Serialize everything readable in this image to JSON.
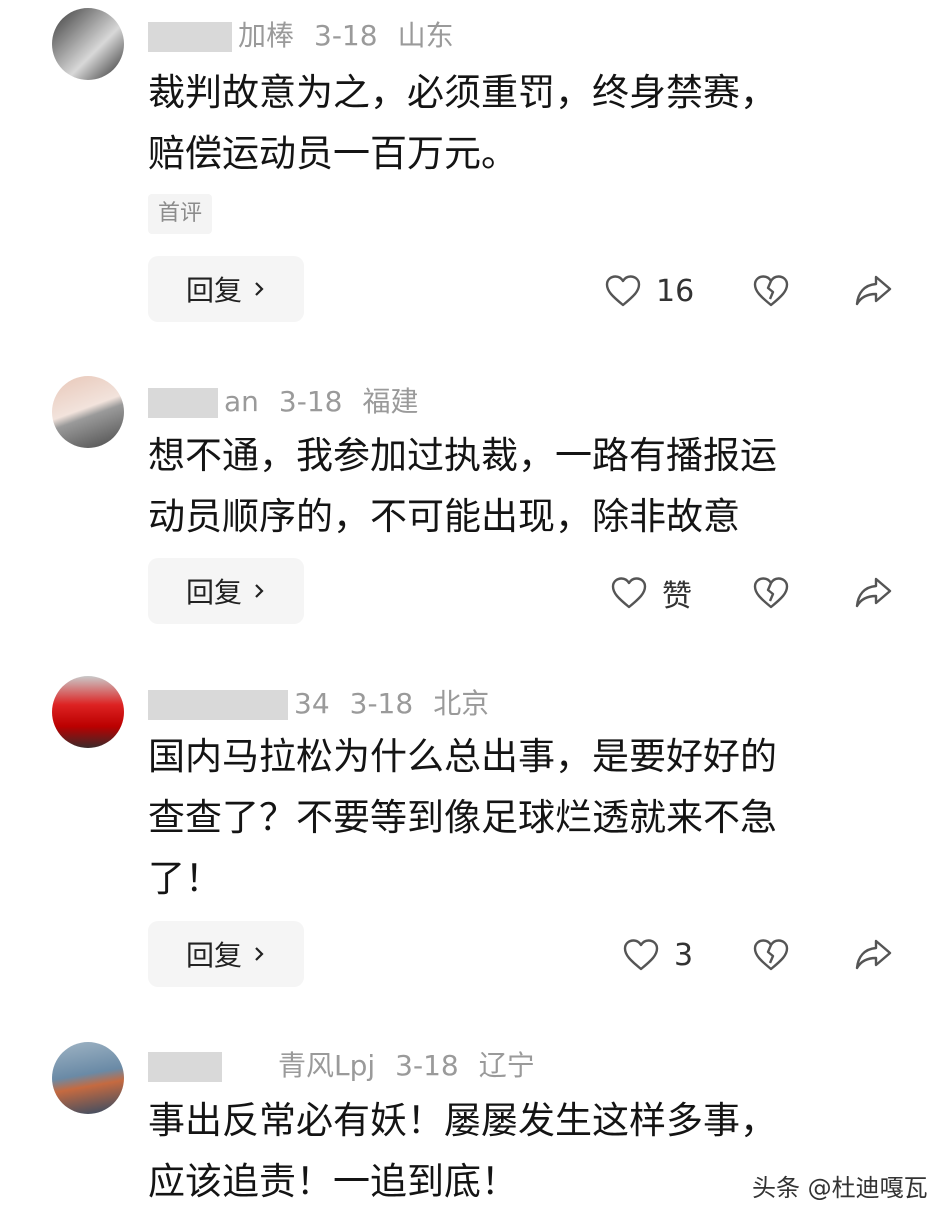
{
  "comments": [
    {
      "name_tail": "加棒",
      "date": "3-18",
      "location": "山东",
      "text_lines": [
        "裁判故意为之，必须重罚，终身禁赛，",
        "赔偿运动员一百万元。"
      ],
      "tag": "首评",
      "reply_label": "回复",
      "likes": "16"
    },
    {
      "name_tail": "an",
      "date": "3-18",
      "location": "福建",
      "text_lines": [
        "想不通，我参加过执裁，一路有播报运",
        "动员顺序的，不可能出现，除非故意"
      ],
      "reply_label": "回复",
      "likes": "赞"
    },
    {
      "name_tail": "34",
      "date": "3-18",
      "location": "北京",
      "text_lines": [
        "国内马拉松为什么总出事，是要好好的",
        "查查了？不要等到像足球烂透就来不急",
        "了！"
      ],
      "reply_label": "回复",
      "likes": "3"
    },
    {
      "name_tail": "青风Lpj",
      "date": "3-18",
      "location": "辽宁",
      "text_lines": [
        "事出反常必有妖！屡屡发生这样多事，",
        "应该追责！一追到底！"
      ]
    }
  ],
  "icons": {
    "like": "heart-outline-icon",
    "dislike": "broken-heart-icon",
    "share": "share-arrow-icon",
    "reply_chevron": "chevron-right-icon"
  },
  "watermark": "头条 @杜迪嘎瓦",
  "colors": {
    "text": "#141414",
    "meta": "#9a9a9a",
    "button_bg": "#f5f5f5",
    "icon": "#555555"
  }
}
